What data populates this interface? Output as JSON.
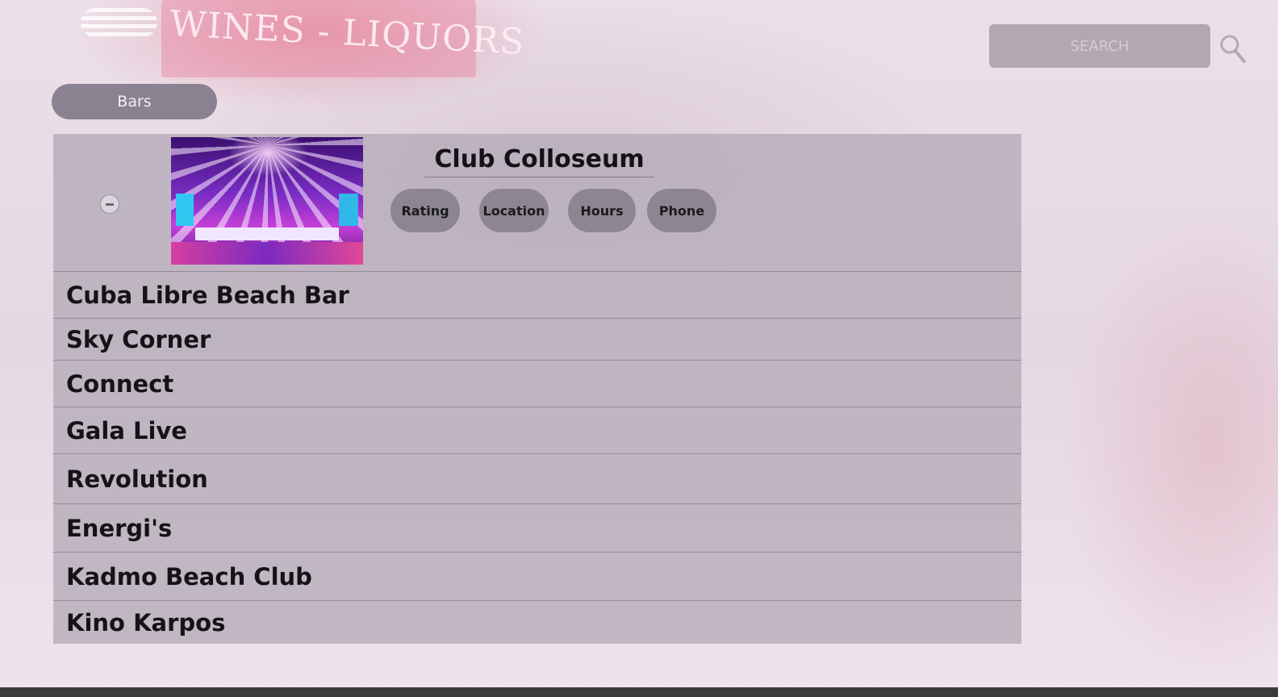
{
  "header": {
    "sign_text": "WINES - LIQUORS",
    "search_placeholder": "SEARCH"
  },
  "category": {
    "label": "Bars"
  },
  "featured": {
    "name": "Club Colloseum",
    "buttons": [
      "Rating",
      "Location",
      "Hours",
      "Phone"
    ]
  },
  "venues": [
    "Cuba Libre Beach Bar",
    "Sky Corner",
    "Connect",
    "Gala Live",
    "Revolution",
    "Energi's",
    "Kadmo Beach Club",
    "Kino Karpos"
  ]
}
